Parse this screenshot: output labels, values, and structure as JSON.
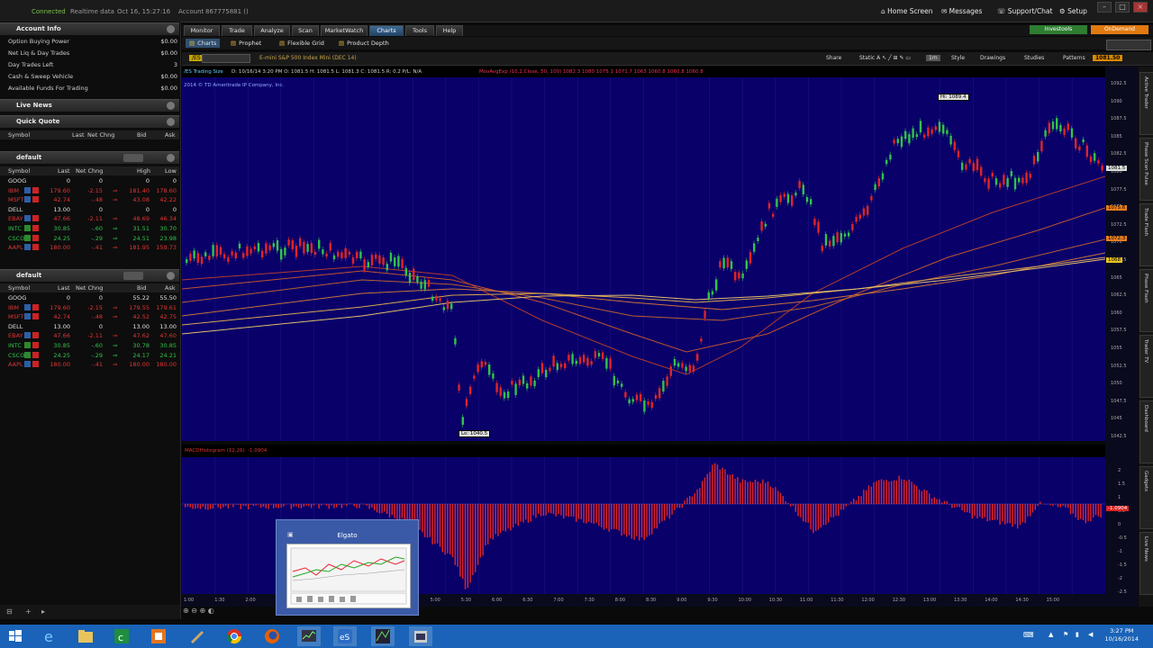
{
  "topbar": {
    "connected": "Connected",
    "realtime": "Realtime data",
    "datetime": "Oct 16, 15:27:16",
    "account_label": "Account",
    "account_value": "867775881 ()",
    "home_screen": "Home Screen",
    "messages": "Messages",
    "support_chat": "Support/Chat",
    "setup": "Setup"
  },
  "account_info": {
    "title": "Account Info",
    "rows": [
      {
        "label": "Option Buying Power",
        "value": "$0.00"
      },
      {
        "label": "Net Liq & Day Trades",
        "value": "$0.00"
      },
      {
        "label": "Day Trades Left",
        "value": "3"
      },
      {
        "label": "Cash & Sweep Vehicle",
        "value": "$0.00"
      },
      {
        "label": "Available Funds For Trading",
        "value": "$0.00"
      }
    ]
  },
  "live_news": {
    "title": "Live News"
  },
  "quick_quote": {
    "title": "Quick Quote",
    "cols": {
      "symbol": "Symbol",
      "last": "Last",
      "net_chng": "Net Chng",
      "bid": "Bid",
      "ask": "Ask"
    }
  },
  "watchlist1": {
    "title": "default",
    "cols": {
      "symbol": "Symbol",
      "last": "Last",
      "net_chng": "Net Chng",
      "high": "High",
      "low": "Low"
    },
    "rows": [
      {
        "sym": "GOOG",
        "last": "0",
        "chg": "0",
        "c3": "0",
        "c4": "0",
        "color": "wht"
      },
      {
        "sym": "IBM",
        "last": "179.60",
        "chg": "-2.15",
        "c3": "181.40",
        "c4": "178.60",
        "color": "red"
      },
      {
        "sym": "MSFT",
        "last": "42.74",
        "chg": "-.48",
        "c3": "43.08",
        "c4": "42.22",
        "color": "red"
      },
      {
        "sym": "DELL",
        "last": "13.00",
        "chg": "0",
        "c3": "0",
        "c4": "0",
        "color": "wht"
      },
      {
        "sym": "EBAY",
        "last": "47.66",
        "chg": "-2.11",
        "c3": "48.69",
        "c4": "46.34",
        "color": "red"
      },
      {
        "sym": "INTC",
        "last": "30.85",
        "chg": "-.60",
        "c3": "31.51",
        "c4": "30.70",
        "color": "grn"
      },
      {
        "sym": "CSCO",
        "last": "24.25",
        "chg": "-.29",
        "c3": "24.51",
        "c4": "23.98",
        "color": "grn"
      },
      {
        "sym": "AAPL",
        "last": "180.00",
        "chg": "-.41",
        "c3": "181.95",
        "c4": "159.73",
        "color": "red"
      }
    ]
  },
  "watchlist2": {
    "title": "default",
    "cols": {
      "symbol": "Symbol",
      "last": "Last",
      "net_chng": "Net Chng",
      "bid": "Bid",
      "ask": "Ask"
    },
    "rows": [
      {
        "sym": "GOOG",
        "last": "0",
        "chg": "0",
        "c3": "55.22",
        "c4": "55.50",
        "color": "wht"
      },
      {
        "sym": "IBM",
        "last": "179.60",
        "chg": "-2.15",
        "c3": "179.55",
        "c4": "179.61",
        "color": "red"
      },
      {
        "sym": "MSFT",
        "last": "42.74",
        "chg": "-.48",
        "c3": "42.52",
        "c4": "42.75",
        "color": "red"
      },
      {
        "sym": "DELL",
        "last": "13.00",
        "chg": "0",
        "c3": "13.00",
        "c4": "13.00",
        "color": "wht"
      },
      {
        "sym": "EBAY",
        "last": "47.66",
        "chg": "-2.11",
        "c3": "47.62",
        "c4": "47.60",
        "color": "red"
      },
      {
        "sym": "INTC",
        "last": "30.85",
        "chg": "-.60",
        "c3": "30.78",
        "c4": "30.85",
        "color": "grn"
      },
      {
        "sym": "CSCO",
        "last": "24.25",
        "chg": "-.29",
        "c3": "24.17",
        "c4": "24.21",
        "color": "grn"
      },
      {
        "sym": "AAPL",
        "last": "180.00",
        "chg": "-.41",
        "c3": "180.00",
        "c4": "180.00",
        "color": "red"
      }
    ]
  },
  "main_tabs": [
    "Monitor",
    "Trade",
    "Analyze",
    "Scan",
    "MarketWatch",
    "Charts",
    "Tools",
    "Help"
  ],
  "active_tab": "Charts",
  "sub_tabs": [
    "Charts",
    "Prophet",
    "Flexible Grid",
    "Product Depth"
  ],
  "badges": {
    "investools": "Investools",
    "on_demand": "OnDemand"
  },
  "toolbar": {
    "symbol": "/ES",
    "description": "E-mini S&P 500 Index Mini (DEC 14)",
    "share": "Share",
    "style": "Style",
    "drawings": "Drawings",
    "studies": "Studies",
    "patterns": "Patterns",
    "last_price": "1081.50"
  },
  "chart_info": {
    "line": "D: 10/16/14 3:20 PM   O: 1081.5   H: 1081.5   L: 1081.3   C: 1081.5   R: 0.2   P/L: N/A",
    "ma_line": "MovAvgExp (10,2,Close, 50, 100)   1082.3   1080   1075.1   1071.7   1063   1060.8   1060.8   1060.8",
    "copyright": "2014 © TD Ameritrade IP Company, Inc.",
    "high_label": "Hi: 1089.4",
    "low_label": "Lo: 1040.5"
  },
  "osc": {
    "label": "MACDHistogram (12,26)",
    "value": "-1.0904"
  },
  "price_axis": [
    "1092.5",
    "1090",
    "1087.5",
    "1085",
    "1082.5",
    "1080",
    "1077.5",
    "1075",
    "1072.5",
    "1070",
    "1067.5",
    "1065",
    "1062.5",
    "1060",
    "1057.5",
    "1055",
    "1052.5",
    "1050",
    "1047.5",
    "1045",
    "1042.5"
  ],
  "price_tags": [
    "1081.5",
    "1075.6",
    "1072.3",
    "1068"
  ],
  "osc_axis": [
    "2",
    "1.5",
    "1",
    "0.5",
    "0",
    "-0.5",
    "-1",
    "-1.5",
    "-2",
    "-2.5"
  ],
  "osc_tag": "-1.0904",
  "time_axis": [
    "1:00",
    "1:30",
    "2:00",
    "2:30",
    "3:00",
    "3:30",
    "4:00",
    "4:30",
    "5:00",
    "5:30",
    "6:00",
    "6:30",
    "7:00",
    "7:30",
    "8:00",
    "8:30",
    "9:00",
    "9:30",
    "10:00",
    "10:30",
    "11:00",
    "11:30",
    "12:00",
    "12:30",
    "13:00",
    "13:30",
    "14:00",
    "14:30",
    "15:00"
  ],
  "side_tabs": [
    "Active Trader",
    "Phase Scan Pulse",
    "Trade Flash",
    "Phase Flash",
    "Trader TV",
    "Dashboard",
    "Gadgets",
    "Live News"
  ],
  "popup": {
    "title": "Elgato"
  },
  "clock": {
    "time": "3:27 PM",
    "date": "10/16/2014"
  },
  "colors": {
    "chart_bg": "#09006a",
    "candle_up": "#33c24a",
    "candle_down": "#e02525",
    "ma_gold": "#d9a84e",
    "accent_tab": "#2f5c88",
    "taskbar": "#1a63b8"
  }
}
